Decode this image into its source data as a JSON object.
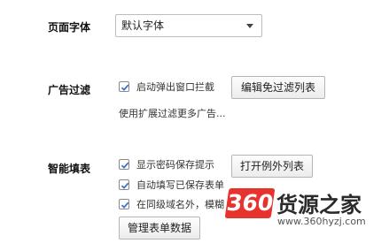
{
  "font": {
    "label": "页面字体",
    "selected": "默认字体",
    "icon": "chevron-down-icon"
  },
  "ads": {
    "label": "广告过滤",
    "option_label": "启动弹出窗口拦截",
    "option_checked": true,
    "button_label": "编辑免过滤列表",
    "hint": "使用扩展过滤更多广告..."
  },
  "autofill": {
    "label": "智能填表",
    "options": [
      {
        "label": "显示密码保存提示",
        "checked": true
      },
      {
        "label": "自动填写已保存表单",
        "checked": true
      },
      {
        "label": "在同级域名外，模糊",
        "checked": true
      }
    ],
    "exceptions_button": "打开例外列表",
    "manage_button": "管理表单数据"
  },
  "watermark": {
    "badge": "360",
    "title": "货源之家",
    "url": "www.360hyzj.com"
  },
  "colors": {
    "check_blue": "#3b73c7",
    "watermark_red": "#e8322e"
  }
}
